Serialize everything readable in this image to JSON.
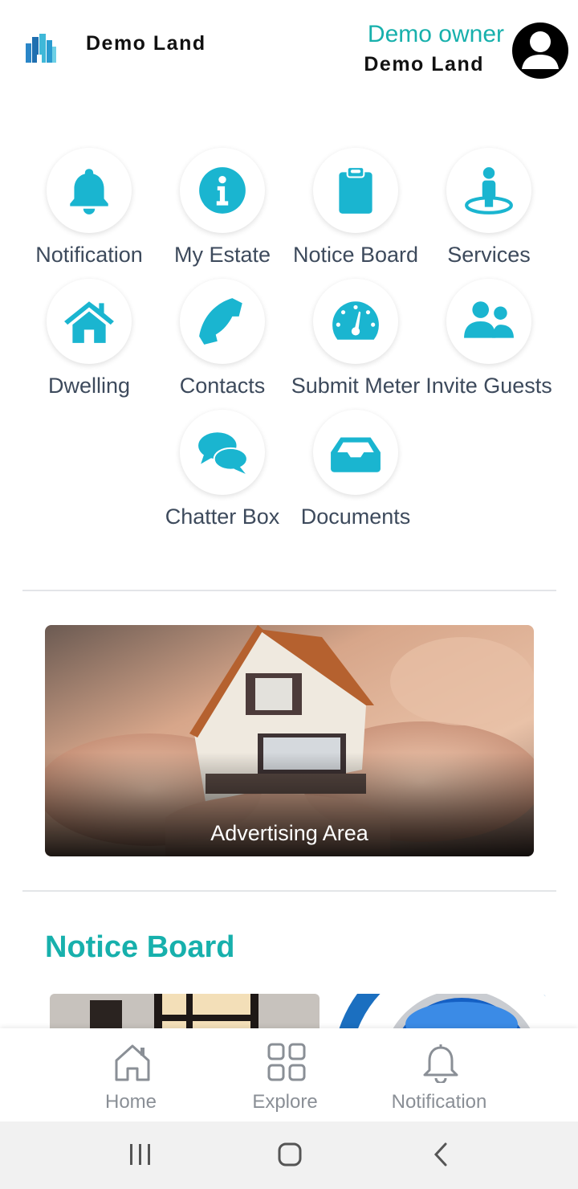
{
  "header": {
    "app_title": "Demo Land",
    "user_role": "Demo owner",
    "user_estate": "Demo Land"
  },
  "menu": [
    {
      "label": "Notification",
      "icon": "bell-icon"
    },
    {
      "label": "My Estate",
      "icon": "info-icon"
    },
    {
      "label": "Notice Board",
      "icon": "clipboard-icon"
    },
    {
      "label": "Services",
      "icon": "person-pin-icon"
    },
    {
      "label": "Dwelling",
      "icon": "house-icon"
    },
    {
      "label": "Contacts",
      "icon": "phone-icon"
    },
    {
      "label": "Submit Meter",
      "icon": "gauge-icon"
    },
    {
      "label": "Invite Guests",
      "icon": "users-icon"
    },
    {
      "label": "Chatter Box",
      "icon": "chat-bubbles-icon"
    },
    {
      "label": "Documents",
      "icon": "inbox-tray-icon"
    }
  ],
  "ad": {
    "label": "Advertising Area"
  },
  "notice_board": {
    "title": "Notice Board"
  },
  "bottom_nav": [
    {
      "label": "Home",
      "icon": "home-icon"
    },
    {
      "label": "Explore",
      "icon": "grid-icon"
    },
    {
      "label": "Notification",
      "icon": "bell-outline-icon"
    }
  ],
  "system_nav": [
    "recent-apps-icon",
    "home-circle-icon",
    "back-chevron-icon"
  ],
  "colors": {
    "accent": "#1ab5d0",
    "title_teal": "#17b0ac",
    "text": "#3d4a5c",
    "nav_grey": "#8a8f96"
  }
}
